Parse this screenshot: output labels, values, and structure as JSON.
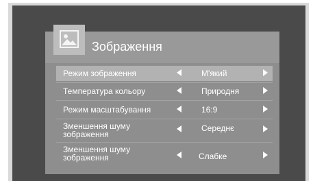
{
  "menu": {
    "title": "Зображення",
    "header_icon": "picture-icon",
    "items": [
      {
        "label": "Режим зображення",
        "value": "М'який"
      },
      {
        "label": "Температура кольору",
        "value": "Природня"
      },
      {
        "label": "Режим масштабування",
        "value": "16:9"
      },
      {
        "label": "Зменшення шуму зображення",
        "value": "Середнє"
      },
      {
        "label": "Зменшення шуму зображення",
        "value": "Слабке"
      }
    ]
  }
}
